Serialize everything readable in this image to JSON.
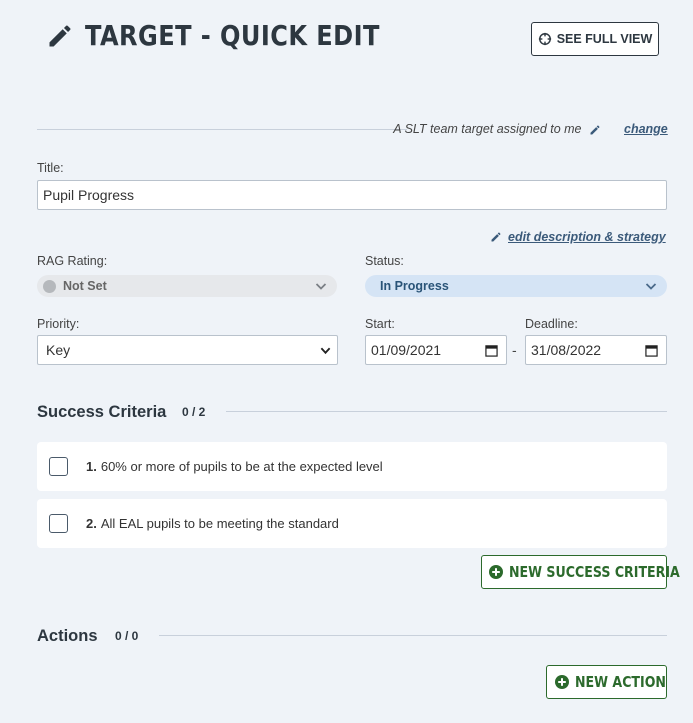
{
  "header": {
    "title": "TARGET - QUICK EDIT",
    "full_view_label": "SEE FULL VIEW"
  },
  "assignment": {
    "text": "A SLT team target assigned to me",
    "change_label": "change"
  },
  "title_field": {
    "label": "Title:",
    "value": "Pupil Progress"
  },
  "edit_description_label": "edit description & strategy",
  "rag": {
    "label": "RAG Rating:",
    "value": "Not Set"
  },
  "status": {
    "label": "Status:",
    "value": "In Progress"
  },
  "priority": {
    "label": "Priority:",
    "value": "Key"
  },
  "start": {
    "label": "Start:",
    "value": "01/09/2021"
  },
  "deadline": {
    "label": "Deadline:",
    "value": "31/08/2022"
  },
  "date_separator": "-",
  "success_criteria": {
    "title": "Success Criteria",
    "count": "0 / 2",
    "items": [
      {
        "number": "1.",
        "text": "60% or more of pupils to be at the expected level"
      },
      {
        "number": "2.",
        "text": "All EAL pupils to be meeting the standard"
      }
    ],
    "new_label": "NEW SUCCESS CRITERIA"
  },
  "actions": {
    "title": "Actions",
    "count": "0 / 0",
    "new_label": "NEW ACTION"
  },
  "colors": {
    "background": "#eff3f8",
    "heading": "#2d3740",
    "link": "#3b5a7a",
    "status_fill": "#d5e4f5",
    "rag_fill": "#e6e8eb",
    "green": "#2c6a2c"
  },
  "icons": {
    "title": "pencil-icon",
    "full_view": "crosshair-icon",
    "change": "pencil-icon",
    "edit_description": "pencil-icon",
    "select": "chevron-down-icon",
    "date": "calendar-icon",
    "new": "plus-circle-icon"
  }
}
